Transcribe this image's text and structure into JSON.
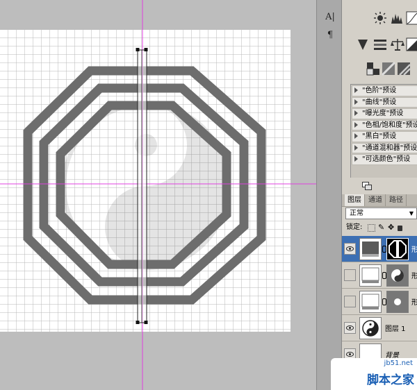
{
  "toolbar": {
    "tools": [
      {
        "icon": "character-panel-icon",
        "glyph": "A|"
      },
      {
        "icon": "paragraph-panel-icon",
        "glyph": "¶"
      }
    ]
  },
  "adjustments": {
    "presets": [
      "\"色阶\"预设",
      "\"曲线\"预设",
      "\"曝光度\"预设",
      "\"色相/饱和度\"预设",
      "\"黑白\"预设",
      "\"通道混和器\"预设",
      "\"可选颜色\"预设"
    ]
  },
  "layers_panel": {
    "tabs": [
      {
        "label": "图层",
        "active": true
      },
      {
        "label": "通道",
        "active": false
      },
      {
        "label": "路径",
        "active": false
      }
    ],
    "blend_mode": "正常",
    "lock_label": "锁定:",
    "layers": [
      {
        "name": "形",
        "visible": true,
        "selected": true,
        "thumb": "octagon-mask-icon"
      },
      {
        "name": "形",
        "visible": false,
        "selected": false,
        "thumb": "circle-mask-icon"
      },
      {
        "name": "形",
        "visible": false,
        "selected": false,
        "thumb": "dot-mask-icon"
      },
      {
        "name": "图层 1",
        "visible": true,
        "selected": false,
        "thumb": "yin-yang-icon"
      },
      {
        "name": "背景",
        "visible": true,
        "selected": false,
        "thumb": "blank-thumb"
      }
    ]
  },
  "watermark": {
    "domain": "jb51.net",
    "name": "脚本之家"
  },
  "colors": {
    "guide": "#e040e0",
    "shape_fill": "#6d6d6d",
    "selection": "#3c6fb3"
  }
}
